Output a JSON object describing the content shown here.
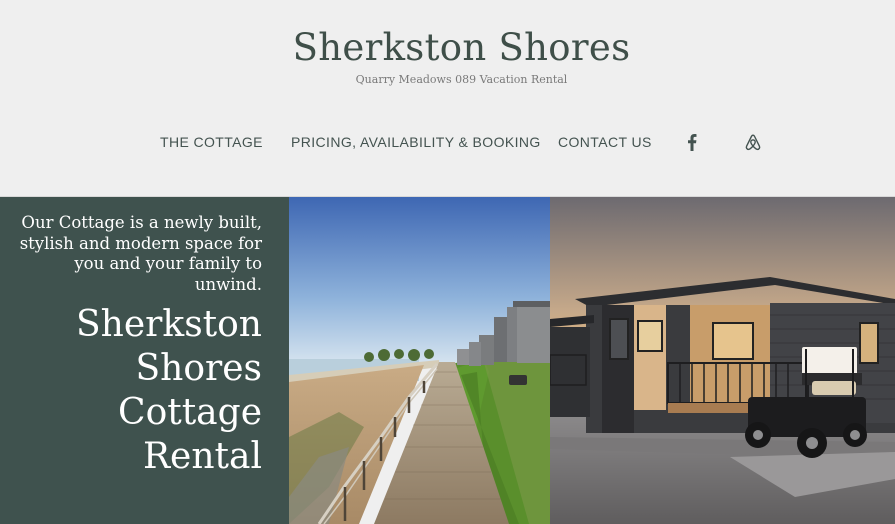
{
  "site": {
    "title": "Sherkston Shores",
    "subtitle": "Quarry Meadows 089 Vacation Rental"
  },
  "nav": {
    "items": [
      {
        "label": "THE COTTAGE"
      },
      {
        "label": "PRICING, AVAILABILITY & BOOKING"
      },
      {
        "label": "CONTACT US"
      }
    ],
    "icons": [
      "facebook-icon",
      "airbnb-icon"
    ]
  },
  "hero": {
    "tagline": "Our Cottage is a newly built, stylish and modern space for you and your family to unwind.",
    "title_lines": [
      "Sherkston",
      "Shores",
      "Cottage",
      "Rental"
    ]
  },
  "colors": {
    "panel": "#3f524e",
    "header_bg": "#efefef",
    "title": "#3f4f49",
    "nav_text": "#445350"
  }
}
